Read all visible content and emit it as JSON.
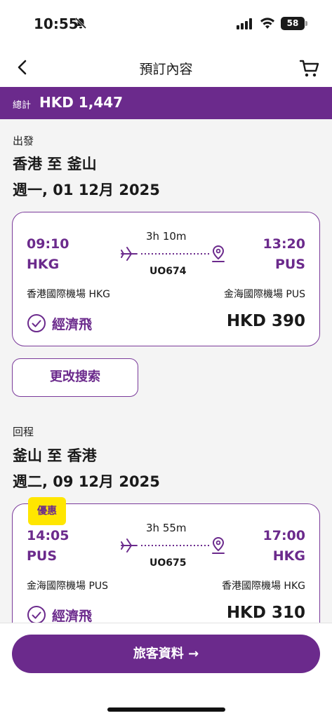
{
  "status_bar": {
    "time": "10:55",
    "battery": "58"
  },
  "nav": {
    "title": "預訂內容"
  },
  "total": {
    "label": "總計",
    "amount": "HKD 1,447"
  },
  "outbound": {
    "section_label": "出發",
    "route": "香港 至 釜山",
    "date": "週一, 01 12月 2025",
    "flight": {
      "dep_time": "09:10",
      "dep_code": "HKG",
      "arr_time": "13:20",
      "arr_code": "PUS",
      "duration": "3h 10m",
      "flight_no": "UO674",
      "dep_airport": "香港國際機場 HKG",
      "arr_airport": "金海國際機場 PUS",
      "fare_class": "經濟飛",
      "price": "HKD 390"
    },
    "change_search": "更改搜索"
  },
  "return": {
    "section_label": "回程",
    "route": "釜山 至 香港",
    "date": "週二, 09 12月 2025",
    "flight": {
      "badge": "優惠",
      "dep_time": "14:05",
      "dep_code": "PUS",
      "arr_time": "17:00",
      "arr_code": "HKG",
      "duration": "3h 55m",
      "flight_no": "UO675",
      "dep_airport": "金海國際機場 PUS",
      "arr_airport": "香港國際機場 HKG",
      "fare_class": "經濟飛",
      "price": "HKD 310"
    }
  },
  "cta": {
    "label": "旅客資料 →"
  },
  "colors": {
    "brand": "#6b2a8c",
    "badge": "#ffe600"
  },
  "icons": [
    "bell-slash-icon",
    "signal-icon",
    "wifi-icon",
    "back-chevron-icon",
    "cart-icon",
    "plane-icon",
    "location-pin-icon",
    "check-circle-icon"
  ]
}
